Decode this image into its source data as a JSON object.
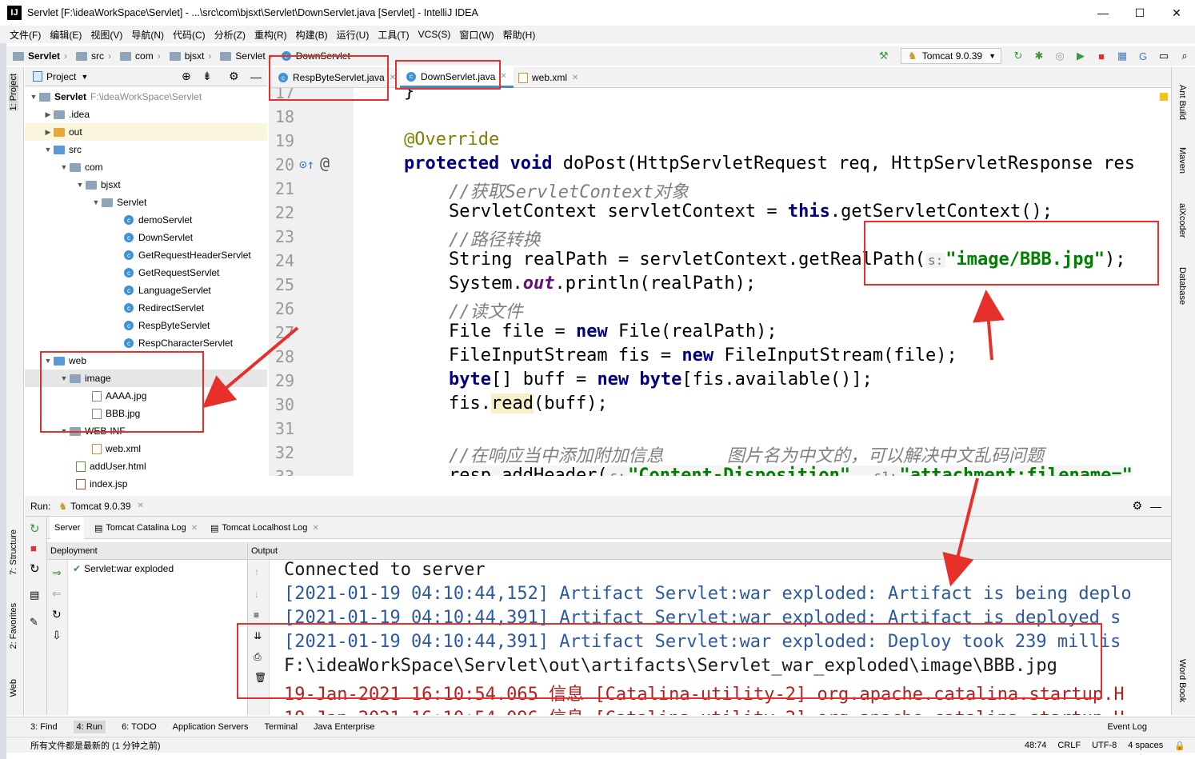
{
  "window": {
    "title": "Servlet [F:\\ideaWorkSpace\\Servlet] - ...\\src\\com\\bjsxt\\Servlet\\DownServlet.java [Servlet] - IntelliJ IDEA",
    "logo": "IJ",
    "min": "—",
    "max": "☐",
    "close": "✕"
  },
  "menu": [
    "文件(F)",
    "编辑(E)",
    "视图(V)",
    "导航(N)",
    "代码(C)",
    "分析(Z)",
    "重构(R)",
    "构建(B)",
    "运行(U)",
    "工具(T)",
    "VCS(S)",
    "窗口(W)",
    "帮助(H)"
  ],
  "breadcrumb": [
    "Servlet",
    "src",
    "com",
    "bjsxt",
    "Servlet",
    "DownServlet"
  ],
  "run_config": "Tomcat 9.0.39",
  "project_panel": {
    "title": "Project",
    "root_name": "Servlet",
    "root_path": "F:\\ideaWorkSpace\\Servlet",
    "items": [
      ".idea",
      "out",
      "src",
      "com",
      "bjsxt",
      "Servlet",
      "demoServlet",
      "DownServlet",
      "GetRequestHeaderServlet",
      "GetRequestServlet",
      "LanguageServlet",
      "RedirectServlet",
      "RespByteServlet",
      "RespCharacterServlet",
      "web",
      "image",
      "AAAA.jpg",
      "BBB.jpg",
      "WEB-INF",
      "web.xml",
      "addUser.html",
      "index.jsp"
    ]
  },
  "editor_tabs": [
    "RespByteServlet.java",
    "DownServlet.java",
    "web.xml"
  ],
  "line_numbers": [
    "17",
    "18",
    "19",
    "20",
    "21",
    "22",
    "23",
    "24",
    "25",
    "26",
    "27",
    "28",
    "29",
    "30",
    "31",
    "32",
    "33"
  ],
  "code": {
    "l17": "}",
    "l19": "@Override",
    "l20_kw1": "protected",
    "l20_kw2": "void",
    "l20_rest": " doPost(HttpServletRequest req, HttpServletResponse res",
    "l21": "//获取ServletContext对象",
    "l22_a": "ServletContext servletContext = ",
    "l22_kw": "this",
    "l22_b": ".getServletContext();",
    "l23": "//路径转换",
    "l24_a": "String realPath = servletContext.getRealPath(",
    "l24_hint": "s:",
    "l24_str": "\"image/BBB.jpg\"",
    "l24_b": ");",
    "l25_a": "System.",
    "l25_out": "out",
    "l25_b": ".println(realPath);",
    "l26": "//读文件",
    "l27_a": "File file = ",
    "l27_kw": "new",
    "l27_b": " File(realPath);",
    "l28_a": "FileInputStream fis = ",
    "l28_kw": "new",
    "l28_b": " FileInputStream(file);",
    "l29_kw1": "byte",
    "l29_a": "[] buff = ",
    "l29_kw2": "new",
    "l29_kw3": " byte",
    "l29_b": "[fis.available()];",
    "l30_a": "fis.",
    "l30_read": "read",
    "l30_b": "(buff);",
    "l32": "//在响应当中添加附加信息      图片名为中文的，可以解决中文乱码问题",
    "l33_a": "resp.addHeader(",
    "l33_h1": "s:",
    "l33_s1": "\"Content-Disposition\"",
    "l33_mid": ", ",
    "l33_h2": "s1:",
    "l33_s2": "\"attachment;filename=\""
  },
  "run_panel": {
    "label": "Run:",
    "config": "Tomcat 9.0.39",
    "subtabs": [
      "Server",
      "Tomcat Catalina Log",
      "Tomcat Localhost Log"
    ],
    "deployment_header": "Deployment",
    "output_header": "Output",
    "deployment_item": "Servlet:war exploded"
  },
  "output_lines": [
    "Connected to server",
    "[2021-01-19 04:10:44,152] Artifact Servlet:war exploded: Artifact is being deplo",
    "[2021-01-19 04:10:44,391] Artifact Servlet:war exploded: Artifact is deployed s",
    "[2021-01-19 04:10:44,391] Artifact Servlet:war exploded: Deploy took 239 millis",
    "F:\\ideaWorkSpace\\Servlet\\out\\artifacts\\Servlet_war_exploded\\image\\BBB.jpg",
    "19-Jan-2021 16:10:54.065 信息 [Catalina-utility-2] org.apache.catalina.startup.H",
    "19-Jan-2021 16:10:54.096 信息 [Catalina-utility-2] org.apache.catalina.startup.H"
  ],
  "left_tools": [
    "1: Project",
    "7: Structure",
    "2: Favorites",
    "Web"
  ],
  "right_tools": [
    "Ant Build",
    "Maven",
    "aiXcoder",
    "Database",
    "Word Book"
  ],
  "bottom_tools": [
    "3: Find",
    "4: Run",
    "6: TODO",
    "Application Servers",
    "Terminal",
    "Java Enterprise",
    "Event Log"
  ],
  "status": {
    "message": "所有文件都是最新的 (1 分钟之前)",
    "position": "48:74",
    "line_sep": "CRLF",
    "encoding": "UTF-8",
    "indent": "4 spaces"
  },
  "colors": {
    "annotation_red": "#e8302b",
    "keyword": "#000080",
    "string": "#008000",
    "comment": "#808080"
  }
}
